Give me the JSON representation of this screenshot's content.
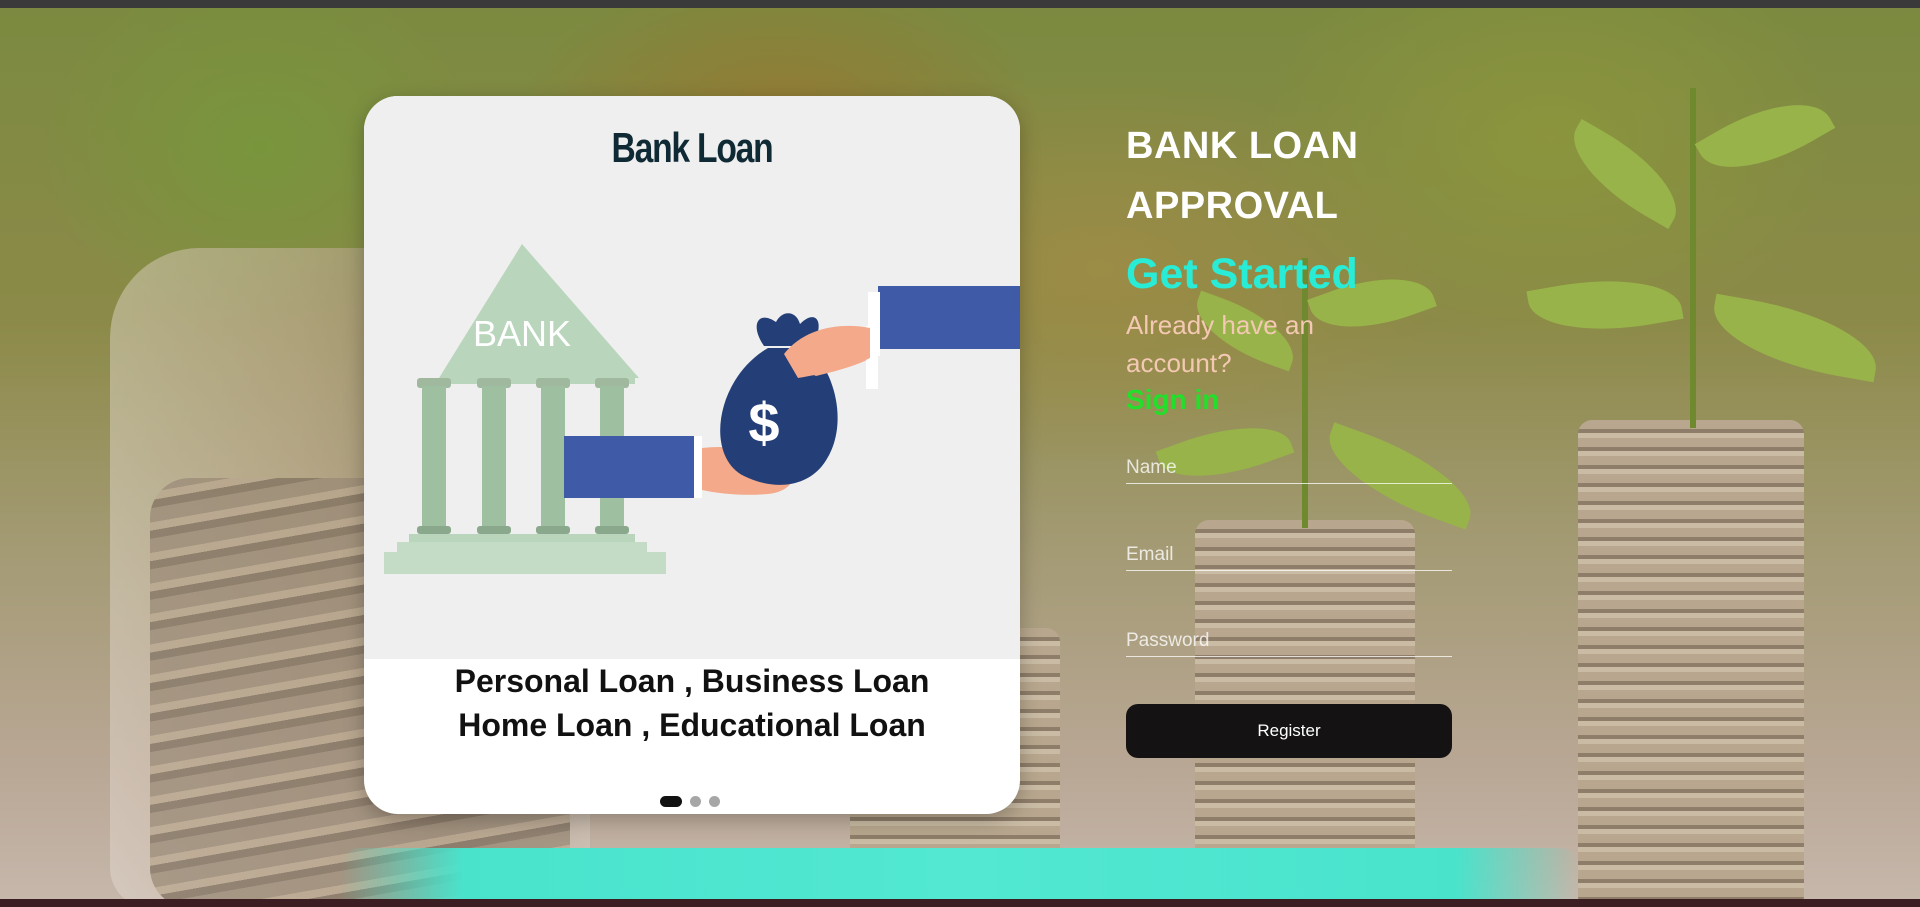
{
  "card": {
    "title": "Bank Loan",
    "bank_sign": "BANK",
    "dollar_sign": "$",
    "caption_line1": "Personal Loan , Business Loan",
    "caption_line2": "Home Loan , Educational Loan",
    "slides": {
      "count": 3,
      "active_index": 0
    }
  },
  "hero": {
    "headline_line1": "BANK LOAN",
    "headline_line2": "APPROVAL",
    "get_started": "Get Started",
    "already_text": "Already have an account?",
    "signin_label": "Sign in"
  },
  "form": {
    "name_placeholder": "Name",
    "email_placeholder": "Email",
    "password_placeholder": "Password",
    "register_label": "Register"
  },
  "colors": {
    "accent_teal": "#29ecd6",
    "signin_green": "#22e02a",
    "already_peach": "#f4c9b4",
    "register_bg": "#141212",
    "card_title": "#0f2a35"
  }
}
